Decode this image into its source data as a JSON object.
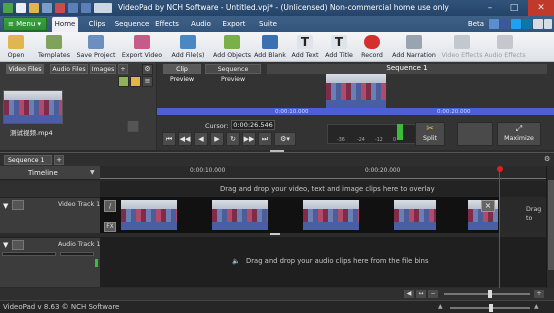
{
  "window": {
    "title": "VideoPad by NCH Software - Untitled.vpj* - (Unlicensed) Non-commercial home use only",
    "controls": {
      "minimize": "–",
      "maximize": "□",
      "close": "✕"
    }
  },
  "menu": {
    "menu_button": "≡ Menu ▾",
    "tabs": [
      "Home",
      "Clips",
      "Sequence",
      "Effects",
      "Audio",
      "Export",
      "Suite"
    ],
    "active_tab": "Home",
    "beta": "Beta"
  },
  "toolbar": {
    "open": "Open",
    "templates": "Templates",
    "save_project": "Save Project",
    "export_video": "Export Video",
    "add_files": "Add File(s)",
    "add_objects": "Add Objects",
    "add_blank": "Add Blank",
    "add_text": "Add Text",
    "add_title": "Add Title",
    "record": "Record",
    "add_narration": "Add Narration",
    "video_effects": "Video Effects",
    "audio_effects": "Audio Effects"
  },
  "bins": {
    "tabs": [
      "Video Files",
      "Audio Files",
      "Images",
      "+"
    ],
    "file_name": "测试视频.mp4"
  },
  "preview": {
    "tabs": [
      "Clip Preview",
      "Sequence Preview"
    ],
    "sequence_title": "Sequence 1",
    "ruler_times": [
      "0:00:10.000",
      "0:00:20.000"
    ],
    "cursor_label": "Cursor:",
    "cursor_value": "0:00:26.546",
    "meter_labels": [
      "-36",
      "-24",
      "-12",
      "0"
    ],
    "split_label": "Split",
    "maximize_label": "Maximize"
  },
  "sequence": {
    "tab_label": "Sequence 1",
    "tab_close": "✕",
    "add_tab": "+",
    "timeline_label": "Timeline",
    "ruler_times": [
      "0:00:10.000",
      "0:00:20.000"
    ],
    "overlay_hint": "Drag and drop your video, text and image clips here to overlay",
    "video_track": "Video Track 1",
    "audio_track": "Audio Track 1",
    "audio_hint": "Drag and drop your audio clips here from the file bins",
    "right_hint": "Drag to",
    "fx_label": "FX"
  },
  "status": {
    "text": "VideoPad v 8.63 © NCH Software"
  },
  "colors": {
    "accent_blue": "#2f5a8a",
    "menu_green": "#35a03a",
    "playhead_red": "#e02020",
    "preview_bar": "#4b5fd6"
  }
}
